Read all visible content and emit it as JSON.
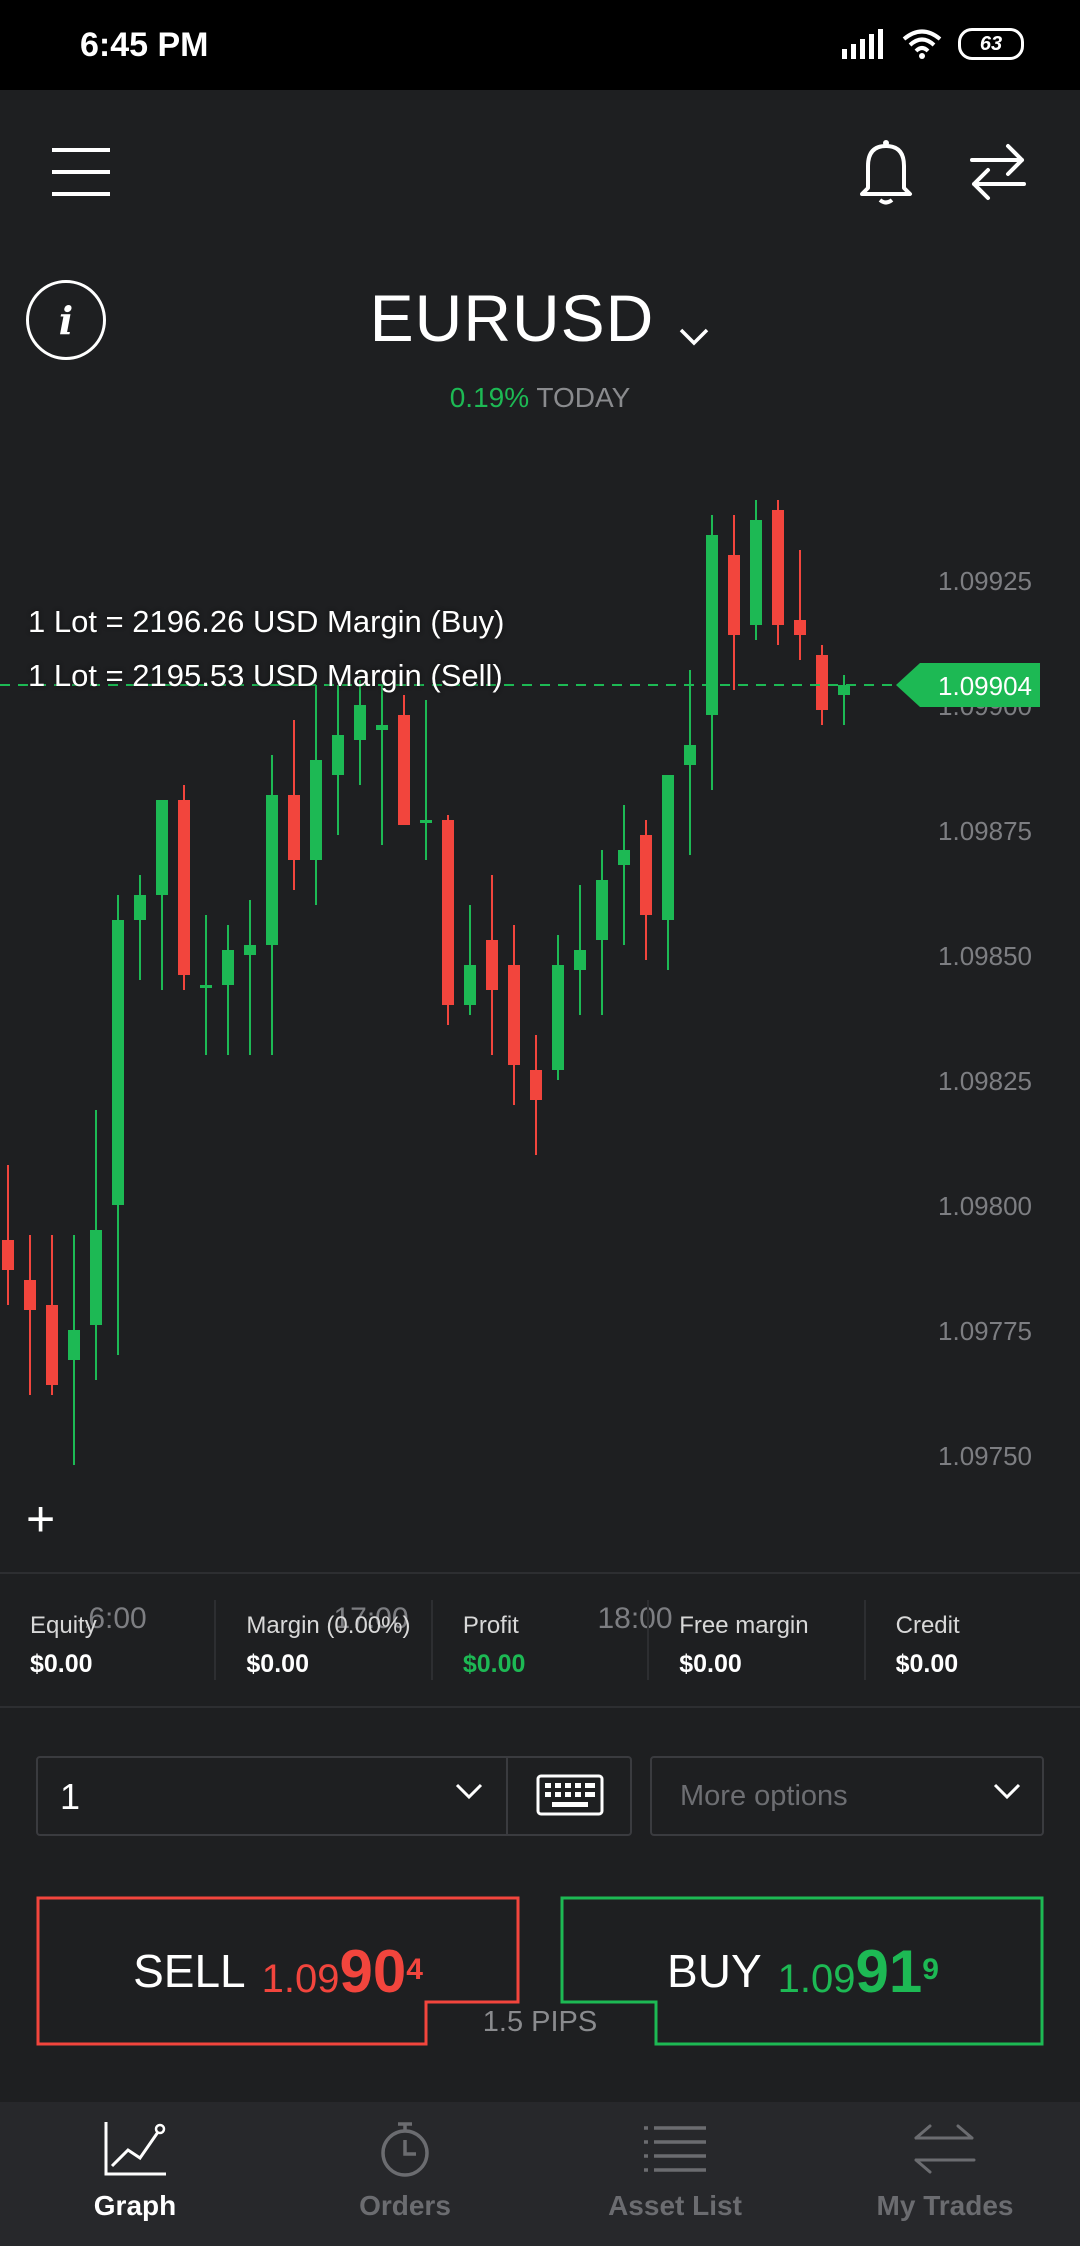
{
  "status_bar": {
    "time": "6:45 PM",
    "battery": "63"
  },
  "header": {
    "menu_icon": "hamburger-menu-icon",
    "bell_icon": "bell-icon",
    "swap_icon": "swap-arrows-icon",
    "info_icon": "info-icon"
  },
  "instrument": {
    "symbol": "EURUSD",
    "change_pct": "0.19%",
    "change_label": "TODAY"
  },
  "margin_info": {
    "buy": "1 Lot = 2196.26 USD Margin (Buy)",
    "sell": "1 Lot = 2195.53 USD Margin (Sell)"
  },
  "chart_data": {
    "type": "candlestick",
    "current_price": "1.09904",
    "y_ticks": [
      "1.09925",
      "1.09900",
      "1.09875",
      "1.09850",
      "1.09825",
      "1.09800",
      "1.09775",
      "1.09750"
    ],
    "ylim": [
      1.09735,
      1.09955
    ],
    "x_ticks": [
      {
        "label": "16:00",
        "index": 4.6
      },
      {
        "label": "17:00",
        "index": 16.5
      },
      {
        "label": "18:00",
        "index": 28.5
      }
    ],
    "up_color": "#1db954",
    "down_color": "#f2453d",
    "candles": [
      {
        "o": 1.09793,
        "h": 1.09808,
        "l": 1.0978,
        "c": 1.09787
      },
      {
        "o": 1.09785,
        "h": 1.09794,
        "l": 1.09762,
        "c": 1.09779
      },
      {
        "o": 1.0978,
        "h": 1.09794,
        "l": 1.09762,
        "c": 1.09764
      },
      {
        "o": 1.09769,
        "h": 1.09794,
        "l": 1.09748,
        "c": 1.09775
      },
      {
        "o": 1.09776,
        "h": 1.09819,
        "l": 1.09765,
        "c": 1.09795
      },
      {
        "o": 1.098,
        "h": 1.09862,
        "l": 1.0977,
        "c": 1.09857
      },
      {
        "o": 1.09857,
        "h": 1.09866,
        "l": 1.09845,
        "c": 1.09862
      },
      {
        "o": 1.09862,
        "h": 1.0988,
        "l": 1.09843,
        "c": 1.09881
      },
      {
        "o": 1.09881,
        "h": 1.09884,
        "l": 1.09843,
        "c": 1.09846
      },
      {
        "o": 1.09844,
        "h": 1.09858,
        "l": 1.0983,
        "c": 1.09844
      },
      {
        "o": 1.09844,
        "h": 1.09856,
        "l": 1.0983,
        "c": 1.09851
      },
      {
        "o": 1.0985,
        "h": 1.09861,
        "l": 1.0983,
        "c": 1.09852
      },
      {
        "o": 1.09852,
        "h": 1.0989,
        "l": 1.0983,
        "c": 1.09882
      },
      {
        "o": 1.09882,
        "h": 1.09897,
        "l": 1.09863,
        "c": 1.09869
      },
      {
        "o": 1.09869,
        "h": 1.09904,
        "l": 1.0986,
        "c": 1.09889
      },
      {
        "o": 1.09886,
        "h": 1.09904,
        "l": 1.09874,
        "c": 1.09894
      },
      {
        "o": 1.09893,
        "h": 1.09905,
        "l": 1.09884,
        "c": 1.099
      },
      {
        "o": 1.09895,
        "h": 1.09904,
        "l": 1.09872,
        "c": 1.09896
      },
      {
        "o": 1.09898,
        "h": 1.09902,
        "l": 1.09877,
        "c": 1.09876
      },
      {
        "o": 1.09877,
        "h": 1.09901,
        "l": 1.09869,
        "c": 1.09877
      },
      {
        "o": 1.09877,
        "h": 1.09878,
        "l": 1.09836,
        "c": 1.0984
      },
      {
        "o": 1.0984,
        "h": 1.0986,
        "l": 1.09838,
        "c": 1.09848
      },
      {
        "o": 1.09853,
        "h": 1.09866,
        "l": 1.0983,
        "c": 1.09843
      },
      {
        "o": 1.09848,
        "h": 1.09856,
        "l": 1.0982,
        "c": 1.09828
      },
      {
        "o": 1.09827,
        "h": 1.09834,
        "l": 1.0981,
        "c": 1.09821
      },
      {
        "o": 1.09827,
        "h": 1.09854,
        "l": 1.09825,
        "c": 1.09848
      },
      {
        "o": 1.09847,
        "h": 1.09864,
        "l": 1.09838,
        "c": 1.09851
      },
      {
        "o": 1.09853,
        "h": 1.09871,
        "l": 1.09838,
        "c": 1.09865
      },
      {
        "o": 1.09868,
        "h": 1.0988,
        "l": 1.09852,
        "c": 1.09871
      },
      {
        "o": 1.09874,
        "h": 1.09877,
        "l": 1.09849,
        "c": 1.09858
      },
      {
        "o": 1.09857,
        "h": 1.09883,
        "l": 1.09847,
        "c": 1.09886
      },
      {
        "o": 1.09888,
        "h": 1.09907,
        "l": 1.0987,
        "c": 1.09892
      },
      {
        "o": 1.09898,
        "h": 1.09938,
        "l": 1.09883,
        "c": 1.09934
      },
      {
        "o": 1.0993,
        "h": 1.09938,
        "l": 1.09903,
        "c": 1.09914
      },
      {
        "o": 1.09916,
        "h": 1.09941,
        "l": 1.09913,
        "c": 1.09937
      },
      {
        "o": 1.09939,
        "h": 1.09941,
        "l": 1.09912,
        "c": 1.09916
      },
      {
        "o": 1.09917,
        "h": 1.09931,
        "l": 1.09909,
        "c": 1.09914
      },
      {
        "o": 1.0991,
        "h": 1.09912,
        "l": 1.09896,
        "c": 1.09899
      },
      {
        "o": 1.09902,
        "h": 1.09906,
        "l": 1.09896,
        "c": 1.09904
      }
    ]
  },
  "chart_controls": {
    "add_label": "+"
  },
  "stats": [
    {
      "label": "Equity",
      "value": "$0.00",
      "highlight": false
    },
    {
      "label": "Margin (0.00%)",
      "value": "$0.00",
      "highlight": false
    },
    {
      "label": "Profit",
      "value": "$0.00",
      "highlight": true
    },
    {
      "label": "Free margin",
      "value": "$0.00",
      "highlight": false
    },
    {
      "label": "Credit",
      "value": "$0.00",
      "highlight": false
    }
  ],
  "order_form": {
    "quantity": "1",
    "keyboard_icon": "keyboard-icon",
    "more_options": "More options"
  },
  "trade": {
    "sell_label": "SELL",
    "sell_price_prefix": "1.09",
    "sell_price_big": "90",
    "sell_price_sup": "4",
    "buy_label": "BUY",
    "buy_price_prefix": "1.09",
    "buy_price_big": "91",
    "buy_price_sup": "9",
    "spread": "1.5 PIPS"
  },
  "bottom_nav": [
    {
      "label": "Graph",
      "icon": "graph-icon",
      "active": true
    },
    {
      "label": "Orders",
      "icon": "stopwatch-icon",
      "active": false
    },
    {
      "label": "Asset List",
      "icon": "list-icon",
      "active": false
    },
    {
      "label": "My Trades",
      "icon": "swap-arrows-icon",
      "active": false
    }
  ],
  "colors": {
    "background": "#1e1f21",
    "up": "#1db954",
    "down": "#f2453d",
    "panel": "#27282b"
  }
}
